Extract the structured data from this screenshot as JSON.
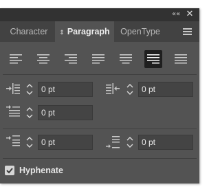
{
  "window": {
    "collapse_glyph": "««",
    "close_glyph": "✕"
  },
  "tabs": [
    {
      "label": "Character",
      "active": false
    },
    {
      "label": "Paragraph",
      "active": true,
      "icon": "swap-icon",
      "icon_glyph": "⌃"
    },
    {
      "label": "OpenType",
      "active": false
    }
  ],
  "alignment_buttons": [
    {
      "name": "align-left",
      "active": false
    },
    {
      "name": "align-center",
      "active": false
    },
    {
      "name": "align-right",
      "active": false
    },
    {
      "name": "justify-last-left",
      "active": false
    },
    {
      "name": "justify-last-center",
      "active": false
    },
    {
      "name": "justify-last-right",
      "active": true
    },
    {
      "name": "justify-all",
      "active": false
    }
  ],
  "fields": {
    "left_indent": {
      "value": "0 pt",
      "icon": "left-indent-icon"
    },
    "right_indent": {
      "value": "0 pt",
      "icon": "right-indent-icon"
    },
    "first_line_indent": {
      "value": "0 pt",
      "icon": "first-line-indent-icon"
    },
    "space_before": {
      "value": "0 pt",
      "icon": "space-before-icon"
    },
    "space_after": {
      "value": "0 pt",
      "icon": "space-after-icon"
    }
  },
  "hyphenate": {
    "label": "Hyphenate",
    "checked": true
  },
  "colors": {
    "panel_bg": "#535353",
    "titlebar_bg": "#323232",
    "tabbar_bg": "#424242",
    "field_bg": "#444444",
    "active_align_bg": "#1f1f1f"
  }
}
